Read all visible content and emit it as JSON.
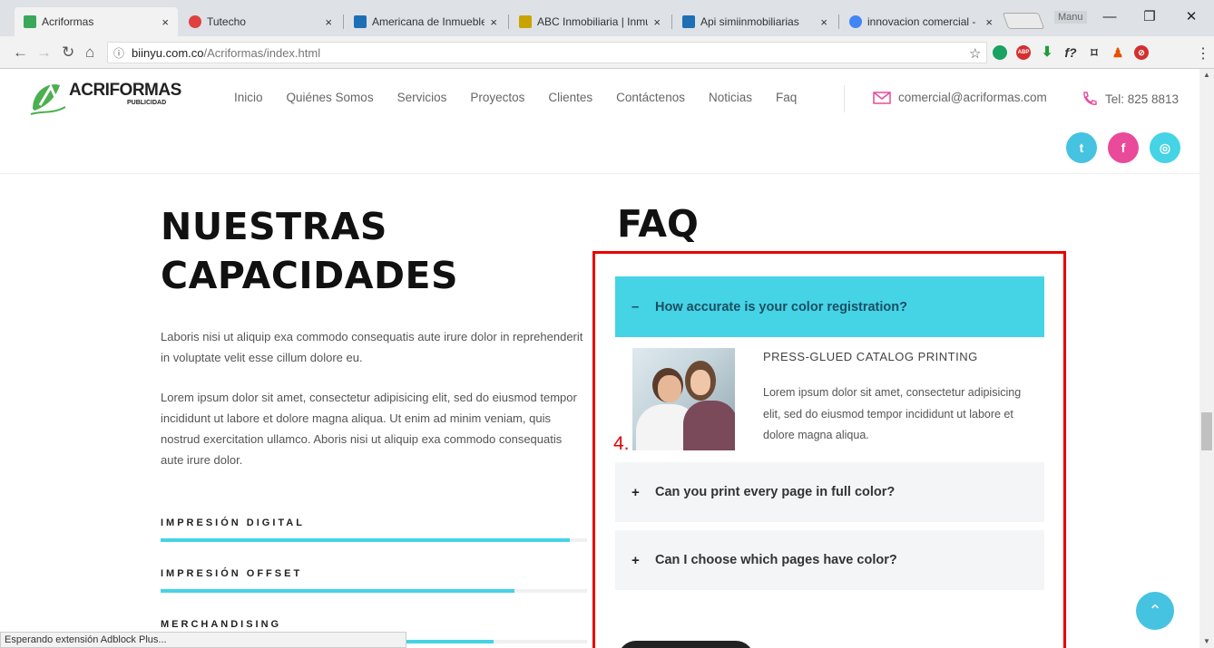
{
  "browser": {
    "tabs": [
      {
        "label": "Acriformas",
        "color": "#3aa85a",
        "active": true
      },
      {
        "label": "Tutecho",
        "color": "#e04040",
        "active": false
      },
      {
        "label": "Americana de Inmueble",
        "color": "#1f6fb5",
        "active": false
      },
      {
        "label": "ABC Inmobiliaria | Inmu",
        "color": "#c9a400",
        "active": false
      },
      {
        "label": "Api simiinmobiliarias",
        "color": "#1f6fb5",
        "active": false
      },
      {
        "label": "innovacion comercial -",
        "color": "#4285f4",
        "active": false
      }
    ],
    "close_glyph": "×",
    "user": "Manu",
    "minimize": "—",
    "maximize": "❐",
    "close": "✕",
    "url_host": "biinyu.com.co",
    "url_path": "/Acriformas/index.html",
    "status_text": "Esperando extensión Adblock Plus..."
  },
  "header": {
    "logo_text": "ACRIFORMAS",
    "logo_sub": "PUBLICIDAD",
    "nav": [
      "Inicio",
      "Quiénes Somos",
      "Servicios",
      "Proyectos",
      "Clientes",
      "Contáctenos",
      "Noticias",
      "Faq"
    ],
    "email": "comercial@acriformas.com",
    "phone": "Tel: 825 8813",
    "social": [
      {
        "icon": "twitter-icon",
        "glyph": "t",
        "color": "#45c3e0"
      },
      {
        "icon": "facebook-icon",
        "glyph": "f",
        "color": "#e94a9a"
      },
      {
        "icon": "instagram-icon",
        "glyph": "◎",
        "color": "#45d3e6"
      }
    ]
  },
  "capacities": {
    "title_line1": "NUESTRAS",
    "title_line2": "CAPACIDADES",
    "para1": "Laboris nisi ut aliquip exa commodo consequatis aute irure dolor in reprehenderit in voluptate velit esse cillum dolore eu.",
    "para2": "Lorem ipsum dolor sit amet, consectetur adipisicing elit, sed do eiusmod tempor incididunt ut labore et dolore magna aliqua. Ut enim ad minim veniam, quis nostrud exercitation ullamco. Aboris nisi ut aliquip exa commodo consequatis aute irure dolor.",
    "skills": [
      {
        "label": "IMPRESIÓN DIGITAL",
        "percent": 96
      },
      {
        "label": "IMPRESIÓN OFFSET",
        "percent": 83
      },
      {
        "label": "MERCHANDISING",
        "percent": 78
      }
    ]
  },
  "faq": {
    "title": "FAQ",
    "items": [
      {
        "sign": "–",
        "question": "How accurate is your color registration?"
      },
      {
        "sign": "+",
        "question": "Can you print every page in full color?"
      },
      {
        "sign": "+",
        "question": "Can I choose which pages have color?"
      }
    ],
    "answer_title": "PRESS-GLUED CATALOG PRINTING",
    "answer_text": "Lorem ipsum dolor sit amet, consectetur adipisicing elit, sed do eiusmod tempor incididunt ut labore et dolore magna aliqua.",
    "annotation": "4.",
    "highlight_color": "#e60000",
    "accent_color": "#45d3e6"
  },
  "back_to_top": "⌃"
}
